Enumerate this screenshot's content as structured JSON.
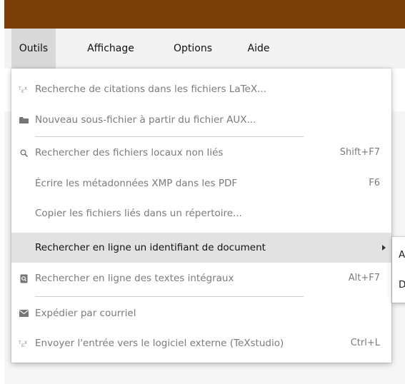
{
  "menubar": {
    "items": [
      {
        "label": "Outils"
      },
      {
        "label": "Affichage"
      },
      {
        "label": "Options"
      },
      {
        "label": "Aide"
      }
    ]
  },
  "dropdown": {
    "items": [
      {
        "label": "Recherche de citations dans les fichiers LaTeX...",
        "icon": "tex-icon",
        "shortcut": ""
      },
      {
        "label": "Nouveau sous-fichier à partir du fichier AUX...",
        "icon": "folder-icon",
        "shortcut": ""
      },
      {
        "label": "Rechercher des fichiers locaux non liés",
        "icon": "search-icon",
        "shortcut": "Shift+F7"
      },
      {
        "label": "Écrire les métadonnées XMP dans les PDF",
        "icon": "",
        "shortcut": "F6"
      },
      {
        "label": "Copier les fichiers liés dans un répertoire...",
        "icon": "",
        "shortcut": ""
      },
      {
        "label": "Rechercher en ligne un identifiant de document",
        "icon": "",
        "shortcut": "",
        "has_submenu": true,
        "highlighted": true
      },
      {
        "label": "Rechercher en ligne des textes intégraux",
        "icon": "document-search-icon",
        "shortcut": "Alt+F7"
      },
      {
        "label": "Expédier par courriel",
        "icon": "envelope-icon",
        "shortcut": ""
      },
      {
        "label": "Envoyer l'entrée vers le logiciel externe (TeXstudio)",
        "icon": "tex-icon",
        "shortcut": "Ctrl+L"
      }
    ]
  },
  "submenu": {
    "items": [
      {
        "label": "A"
      },
      {
        "label": "D"
      }
    ]
  },
  "colors": {
    "titlebar": "#793f06",
    "menubar": "#f3f3f3",
    "highlight": "#e2e2e2",
    "disabled_text": "#7b7b7b"
  }
}
